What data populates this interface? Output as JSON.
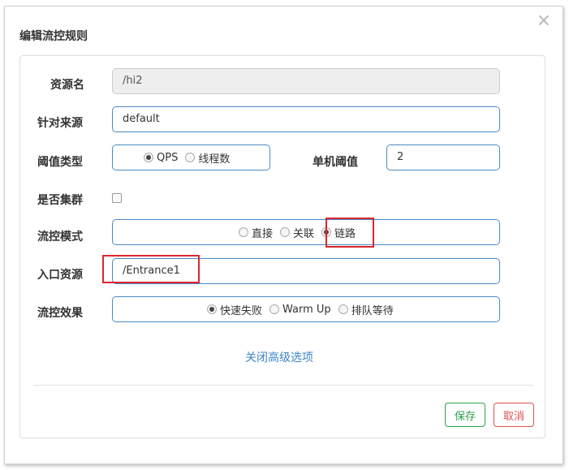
{
  "dialog": {
    "title": "编辑流控规则",
    "close_symbol": "×"
  },
  "form": {
    "resource": {
      "label": "资源名",
      "value": "/hi2"
    },
    "origin": {
      "label": "针对来源",
      "value": "default"
    },
    "threshold_type": {
      "label": "阈值类型",
      "options": [
        "QPS",
        "线程数"
      ],
      "selected": "QPS"
    },
    "single_threshold": {
      "label": "单机阈值",
      "value": "2"
    },
    "cluster": {
      "label": "是否集群",
      "checked": false
    },
    "flow_mode": {
      "label": "流控模式",
      "options": [
        "直接",
        "关联",
        "链路"
      ],
      "selected": "链路"
    },
    "entry_resource": {
      "label": "入口资源",
      "value": "/Entrance1"
    },
    "flow_effect": {
      "label": "流控效果",
      "options": [
        "快速失败",
        "Warm Up",
        "排队等待"
      ],
      "selected": "快速失败"
    },
    "advanced_toggle": "关闭高级选项"
  },
  "footer": {
    "save_label": "保存",
    "cancel_label": "取消"
  },
  "colors": {
    "field_border": "#4a8ac3",
    "link": "#3c86c6",
    "save": "#2e9e4a",
    "cancel": "#d9534f",
    "annotation_red": "#d9262c"
  }
}
